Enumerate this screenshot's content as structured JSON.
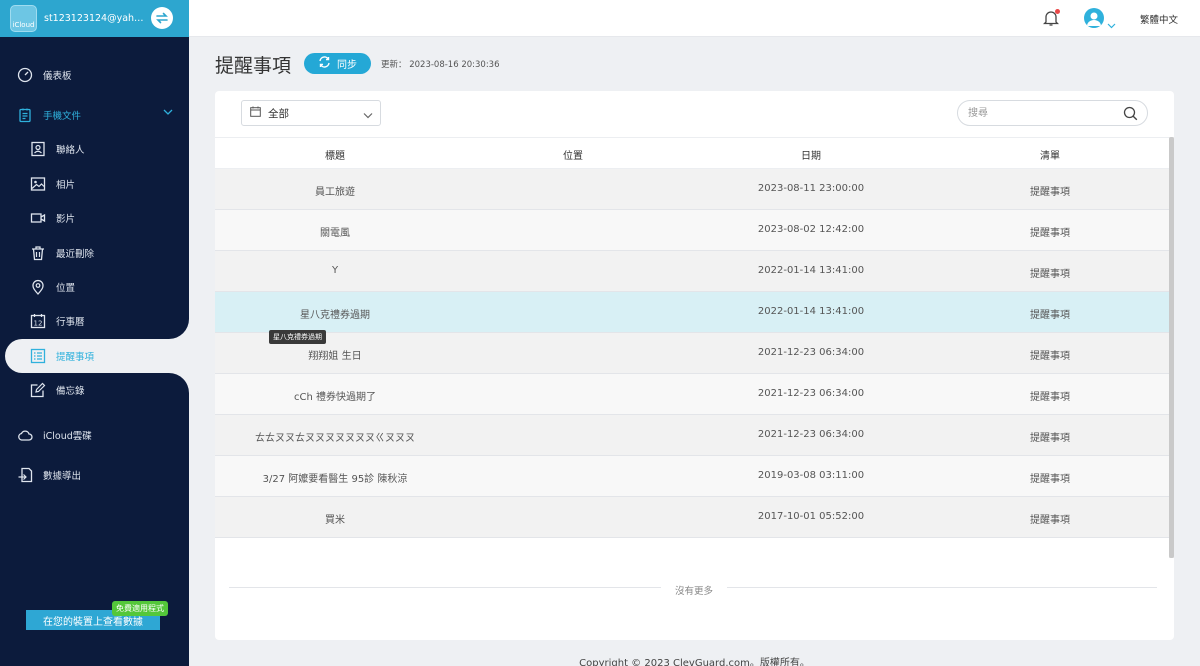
{
  "account": {
    "email": "st123123124@yahoo...",
    "logo_text": "iCloud"
  },
  "sidebar": {
    "items": [
      {
        "label": "儀表板",
        "icon": "dashboard-icon"
      },
      {
        "label": "手機文件",
        "icon": "phone-files-icon"
      },
      {
        "label": "聯絡人",
        "icon": "contacts-icon"
      },
      {
        "label": "相片",
        "icon": "photos-icon"
      },
      {
        "label": "影片",
        "icon": "video-icon"
      },
      {
        "label": "最近刪除",
        "icon": "trash-icon"
      },
      {
        "label": "位置",
        "icon": "location-icon"
      },
      {
        "label": "行事曆",
        "icon": "calendar-icon"
      },
      {
        "label": "提醒事項",
        "icon": "reminders-icon"
      },
      {
        "label": "備忘錄",
        "icon": "notes-icon"
      },
      {
        "label": "iCloud雲碟",
        "icon": "cloud-icon"
      },
      {
        "label": "數據導出",
        "icon": "export-icon"
      }
    ],
    "promo_badge": "免費適用程式",
    "promo_button": "在您的裝置上查看數據"
  },
  "topbar": {
    "language": "繁體中文"
  },
  "header": {
    "title": "提醒事項",
    "sync_label": "同步",
    "update_label": "更新：",
    "update_time": "2023-08-16 20:30:36"
  },
  "filter": {
    "selected": "全部"
  },
  "search": {
    "placeholder": "搜尋"
  },
  "table": {
    "columns": [
      "標題",
      "位置",
      "日期",
      "清單"
    ],
    "rows": [
      {
        "title": "員工旅遊",
        "location": "",
        "date": "2023-08-11 23:00:00",
        "list": "提醒事項"
      },
      {
        "title": "關電風",
        "location": "",
        "date": "2023-08-02 12:42:00",
        "list": "提醒事項"
      },
      {
        "title": "Y",
        "location": "",
        "date": "2022-01-14 13:41:00",
        "list": "提醒事項"
      },
      {
        "title": "星八克禮券過期",
        "location": "",
        "date": "2022-01-14 13:41:00",
        "list": "提醒事項"
      },
      {
        "title": "翔翔姐 生日",
        "location": "",
        "date": "2021-12-23 06:34:00",
        "list": "提醒事項"
      },
      {
        "title": "cCh 禮券快過期了",
        "location": "",
        "date": "2021-12-23 06:34:00",
        "list": "提醒事項"
      },
      {
        "title": "ㄊㄊㄡㄡㄊㄡㄡㄡㄡㄡㄡㄡㄍㄡㄡㄡ",
        "location": "",
        "date": "2021-12-23 06:34:00",
        "list": "提醒事項"
      },
      {
        "title": "3/27 阿嬤要看醫生 95診 陳秋涼",
        "location": "",
        "date": "2019-03-08 03:11:00",
        "list": "提醒事項"
      },
      {
        "title": "買米",
        "location": "",
        "date": "2017-10-01 05:52:00",
        "list": "提醒事項"
      }
    ],
    "tooltip": "星八克禮券過期",
    "no_more": "沒有更多"
  },
  "footer": {
    "copyright": "Copyright © 2023 ClevGuard.com。版權所有。"
  },
  "colors": {
    "accent": "#24a8d6",
    "sidebar_bg": "#0c1b3c",
    "highlight_row": "#d8f0f5"
  }
}
